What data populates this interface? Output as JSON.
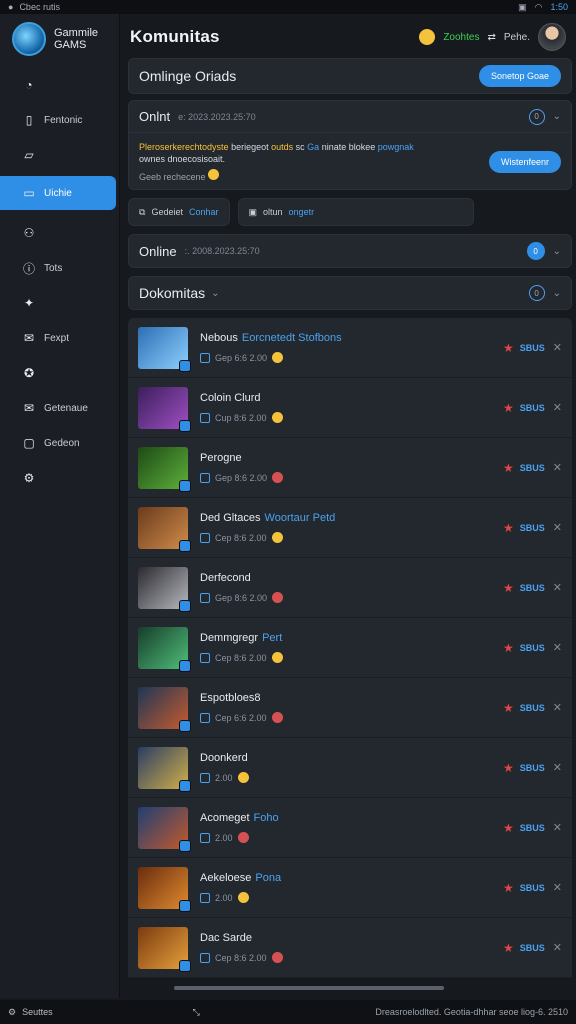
{
  "statusbar": {
    "left_text": "Cbec rutis",
    "time": "1:50"
  },
  "brand": {
    "line1": "Gammile",
    "line2": "GAMS"
  },
  "sidebar": {
    "items": [
      {
        "label": "",
        "icon": "clock-icon"
      },
      {
        "label": "Fentonic",
        "icon": "document-icon"
      },
      {
        "label": "",
        "icon": "edit-icon"
      },
      {
        "label": "Uichie",
        "icon": "chat-icon",
        "active": true
      },
      {
        "label": "",
        "icon": "users-icon"
      },
      {
        "label": "Tots",
        "icon": "info-icon"
      },
      {
        "label": "",
        "icon": "puzzle-icon"
      },
      {
        "label": "Fexpt",
        "icon": "mail-icon"
      },
      {
        "label": "",
        "icon": "lightbulb-icon"
      },
      {
        "label": "Getenaue",
        "icon": "inbox-icon"
      },
      {
        "label": "Gedeon",
        "icon": "calendar-icon"
      },
      {
        "label": "",
        "icon": "settings-icon"
      }
    ]
  },
  "topbar": {
    "title": "Komunitas",
    "status": "Zoohtes",
    "messages": "Pehe."
  },
  "header": {
    "title": "Omlinge Oriads",
    "button": "Sonetop Goae"
  },
  "online": {
    "title": "Onlnt",
    "subtitle": "e:  2023.2023.25:70",
    "circle": "0",
    "notice_hl": "Pleroserkerechtodyste",
    "notice_mid": "beriegeot",
    "notice_hl2": "outds",
    "notice_rest": "sc",
    "notice_blue": "Ga",
    "notice_rest2": "ninate blokee",
    "notice_blue2": "powgnak",
    "notice_line2": "ownes dnoecosisoait.",
    "notice_sub": "Geeb rechecene",
    "notice_button": "Wistenfeenr"
  },
  "actions": [
    {
      "label": "Gedeiet",
      "extra": "Conhar",
      "icon": "copy-icon"
    },
    {
      "label": "oltun",
      "extra": "ongetr",
      "icon": "bookmark-icon"
    }
  ],
  "online2": {
    "title": "Online",
    "subtitle": ":.  2008.2023.25:70",
    "count": "0"
  },
  "favorites": {
    "title": "Dokomitas",
    "circle": "0"
  },
  "games": [
    {
      "name": "Nebous",
      "tag": "Eorcnetedt Stofbons",
      "meta": "Gep 6:6 2.00",
      "score": "SBUS",
      "colors": [
        "#2c6fb3",
        "#8fd0ff"
      ],
      "emoji": "yellow"
    },
    {
      "name": "Coloin Clurd",
      "tag": "",
      "meta": "Cup 8:6 2.00",
      "score": "SBUS",
      "colors": [
        "#3a1f5c",
        "#a14fc4"
      ],
      "emoji": "yellow"
    },
    {
      "name": "Perogne",
      "tag": "",
      "meta": "Gep 8:6 2.00",
      "score": "SBUS",
      "colors": [
        "#1c4a16",
        "#5fb03a"
      ],
      "emoji": "red"
    },
    {
      "name": "Ded Gltaces",
      "tag": "Woortaur Petd",
      "meta": "Cep 8:6 2.00",
      "score": "SBUS",
      "colors": [
        "#6b3b1d",
        "#d08c4a"
      ],
      "emoji": "yellow"
    },
    {
      "name": "Derfecond",
      "tag": "",
      "meta": "Gep 8:6 2.00",
      "score": "SBUS",
      "colors": [
        "#2a2a2f",
        "#b8b8c0"
      ],
      "emoji": "red"
    },
    {
      "name": "Demmgregr",
      "tag": "Pert",
      "meta": "Cep 8:6 2.00",
      "score": "SBUS",
      "colors": [
        "#173d2b",
        "#4fbf7a"
      ],
      "emoji": "yellow"
    },
    {
      "name": "Espotbloes8",
      "tag": "",
      "meta": "Cep 6:6 2.00",
      "score": "SBUS",
      "colors": [
        "#1d3656",
        "#c75b2d"
      ],
      "emoji": "red"
    },
    {
      "name": "Doonkerd",
      "tag": "",
      "meta": "2.00",
      "score": "SBUS",
      "colors": [
        "#2b3d63",
        "#d1b04a"
      ],
      "emoji": "yellow"
    },
    {
      "name": "Acomeget",
      "tag": "Foho",
      "meta": "2.00",
      "score": "SBUS",
      "colors": [
        "#1f3f73",
        "#c25a2c"
      ],
      "emoji": "red"
    },
    {
      "name": "Aekeloese",
      "tag": "Pona",
      "meta": "2.00",
      "score": "SBUS",
      "colors": [
        "#6a2d0f",
        "#e08a2e"
      ],
      "emoji": "yellow"
    },
    {
      "name": "Dac Sarde",
      "tag": "",
      "meta": "Cep 8:6 2.00",
      "score": "SBUS",
      "colors": [
        "#7a3b10",
        "#e8a03c"
      ],
      "emoji": "red"
    }
  ],
  "footer": {
    "left": "Seuttes",
    "right": "Dreasroelodlted. Geotia-dhhar seoe liog-6. 2510"
  }
}
